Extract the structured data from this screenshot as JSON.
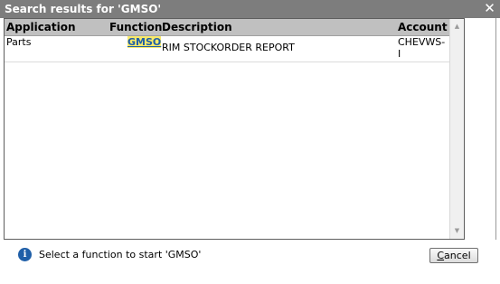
{
  "dialog": {
    "title": "Search results for 'GMSO'",
    "close_glyph": "✕"
  },
  "table": {
    "columns": [
      "Application",
      "Function",
      "Description",
      "Account"
    ],
    "rows": [
      {
        "application": "Parts",
        "function": "GMSO",
        "description": "RIM STOCKORDER REPORT",
        "account": "CHEVWS-I"
      }
    ]
  },
  "footer": {
    "info_icon": "info-icon",
    "message": "Select a function to start 'GMSO'",
    "cancel_first_letter": "C",
    "cancel_rest": "ancel"
  },
  "scrollbar": {
    "up_glyph": "▲",
    "down_glyph": "▼"
  },
  "colors": {
    "titlebar": "#7d7d7d",
    "header": "#c0c0c0",
    "link": "#1f5fa8",
    "link_highlight": "#f7e96b"
  }
}
